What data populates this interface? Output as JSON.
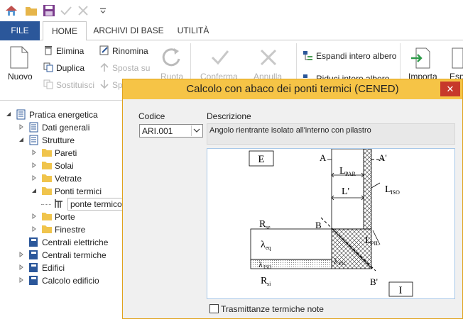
{
  "ribbon_tabs": [
    "FILE",
    "HOME",
    "ARCHIVI DI BASE",
    "UTILITÀ"
  ],
  "ribbon": {
    "nuovo": "Nuovo",
    "elimina": "Elimina",
    "duplica": "Duplica",
    "sostituisci": "Sostituisci",
    "rinomina": "Rinomina",
    "sposta_su": "Sposta su",
    "sposta_giu": "Sp",
    "ruota": "Ruota",
    "conferma": "Conferma",
    "annulla": "Annulla",
    "espandi": "Espandi intero albero",
    "riduci": "Riduci intero albero",
    "importa": "Importa",
    "esporta": "Esp"
  },
  "tree": [
    {
      "label": "Pratica energetica",
      "level": 0,
      "icon": "doc",
      "expander": "open"
    },
    {
      "label": "Dati generali",
      "level": 1,
      "icon": "doc",
      "expander": "closed"
    },
    {
      "label": "Strutture",
      "level": 1,
      "icon": "doc",
      "expander": "open"
    },
    {
      "label": "Pareti",
      "level": 2,
      "icon": "folder",
      "expander": "closed"
    },
    {
      "label": "Solai",
      "level": 2,
      "icon": "folder",
      "expander": "closed"
    },
    {
      "label": "Vetrate",
      "level": 2,
      "icon": "folder",
      "expander": "closed"
    },
    {
      "label": "Ponti termici",
      "level": 2,
      "icon": "folder",
      "expander": "open"
    },
    {
      "label": "ponte termico",
      "level": 3,
      "icon": "bridge",
      "expander": "none",
      "selected": true
    },
    {
      "label": "Porte",
      "level": 2,
      "icon": "folder",
      "expander": "closed"
    },
    {
      "label": "Finestre",
      "level": 2,
      "icon": "folder",
      "expander": "closed"
    },
    {
      "label": "Centrali elettriche",
      "level": 1,
      "icon": "book",
      "expander": "none"
    },
    {
      "label": "Centrali termiche",
      "level": 1,
      "icon": "book",
      "expander": "closed"
    },
    {
      "label": "Edifici",
      "level": 1,
      "icon": "book",
      "expander": "closed"
    },
    {
      "label": "Calcolo edificio",
      "level": 1,
      "icon": "book",
      "expander": "closed"
    }
  ],
  "dialog": {
    "title": "Calcolo con abaco dei ponti termici (CENED)",
    "close": "✕",
    "codice_label": "Codice",
    "codice_value": "ARI.001",
    "descrizione_label": "Descrizione",
    "descrizione_value": "Angolo rientrante isolato all'interno con pilastro",
    "checkbox_label": "Trasmittanze termiche note"
  },
  "figure": {
    "E": "E",
    "I": "I",
    "A": "A",
    "A_prime": "A'",
    "B": "B",
    "B_prime": "B'",
    "L_par": "PAR",
    "L_prime": "L'",
    "L_iso": "ISO",
    "L_pil": "PIL",
    "R_se": "se",
    "R_si": "si",
    "lambda_eq": "eq",
    "lambda_iso": "ISO",
    "lambda_pil": "PIL"
  },
  "colors": {
    "file_tab": "#2b579a",
    "dialog_title": "#f6c446",
    "close_btn": "#c7392b"
  }
}
